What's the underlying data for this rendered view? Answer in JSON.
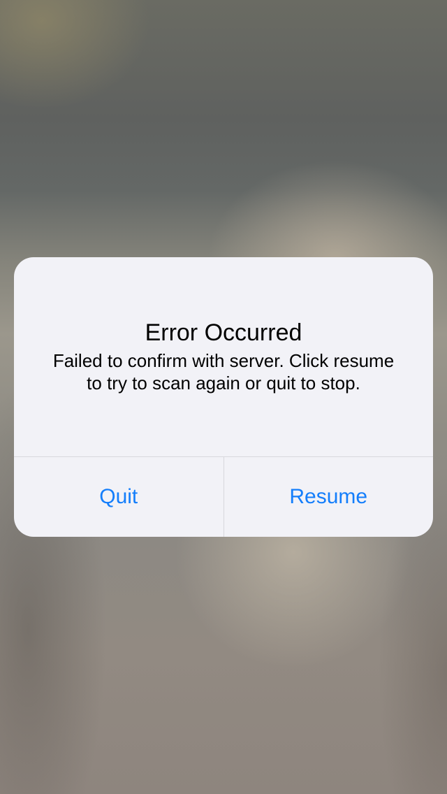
{
  "alert": {
    "title": "Error Occurred",
    "message_line1": "Failed to confirm with server. Click resume",
    "message_line2": "to try to scan again or quit to stop.",
    "buttons": [
      {
        "label": "Quit"
      },
      {
        "label": "Resume"
      }
    ]
  },
  "colors": {
    "alert_background": "#f2f2f7",
    "button_text": "#147efb",
    "separator": "#d7d7dc",
    "title_text": "#000000"
  }
}
